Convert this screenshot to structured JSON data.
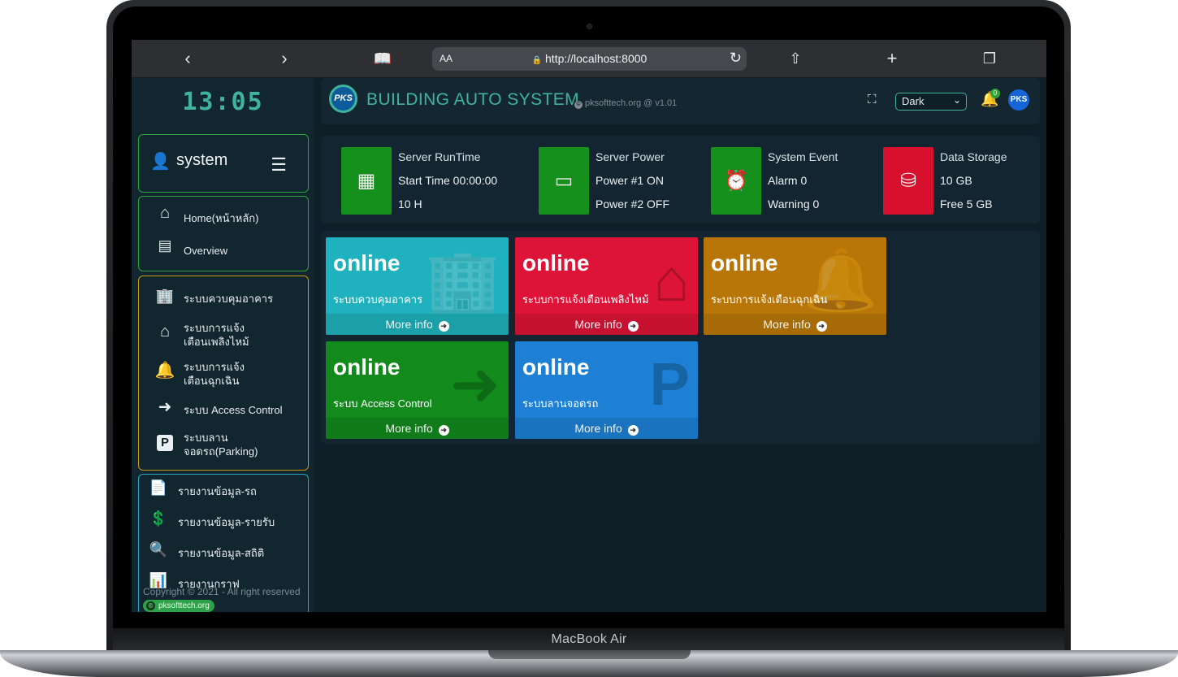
{
  "device": {
    "brand": "MacBook Air"
  },
  "browser": {
    "back_icon": "‹",
    "forward_icon": "›",
    "aa": "AA",
    "url": "http://localhost:8000",
    "lock_icon": "🔒"
  },
  "sidebar": {
    "clock": "13:05",
    "user": {
      "name": "system"
    },
    "menu": [
      {
        "label": "Home(หน้าหลัก)",
        "icon": "home-icon"
      },
      {
        "label": "Overview",
        "icon": "list-icon"
      }
    ],
    "systems": [
      {
        "label": "ระบบควบคุมอาคาร",
        "icon": "building-shield-icon"
      },
      {
        "label": "ระบบการแจ้ง\nเตือนเพลิงไหม้",
        "icon": "house-fire-icon"
      },
      {
        "label": "ระบบการแจ้ง\nเตือนฉุกเฉิน",
        "icon": "bell-icon"
      },
      {
        "label": "ระบบ Access Control",
        "icon": "sign-in-icon"
      },
      {
        "label": "ระบบลาน\nจอดรถ(Parking)",
        "icon": "parking-icon"
      }
    ],
    "reports": [
      {
        "label": "รายงานข้อมูล-รถ",
        "icon": "file-parking-icon"
      },
      {
        "label": "รายงานข้อมูล-รายรับ",
        "icon": "file-invoice-dollar-icon"
      },
      {
        "label": "รายงานข้อมูล-สถิติ",
        "icon": "magnify-chart-icon"
      },
      {
        "label": "รายงานกราฟ",
        "icon": "chart-bar-icon"
      }
    ],
    "copyright": "Copyright © 2021 - All right reserved",
    "badge": "pksofttech.org"
  },
  "topbar": {
    "logo": "PKS",
    "title": "BUILDING AUTO SYSTEM",
    "subtitle": "pksofttech.org  @ v1.01",
    "theme_value": "Dark",
    "notifications": "0",
    "avatar": "PKS"
  },
  "info_boxes": [
    {
      "title": "Server RunTime",
      "line1": "Start Time 00:00:00",
      "line2": "10 H",
      "color": "#16901c",
      "icon": "memory-icon"
    },
    {
      "title": "Server Power",
      "line1": "Power #1 ON",
      "line2": "Power #2 OFF",
      "color": "#16901c",
      "icon": "battery-icon"
    },
    {
      "title": "System Event",
      "line1": "Alarm 0",
      "line2": "Warning 0",
      "color": "#16901c",
      "icon": "toolbox-clock-icon"
    },
    {
      "title": "Data Storage",
      "line1": "10 GB",
      "line2": "Free 5 GB",
      "color": "#d6102d",
      "icon": "database-icon"
    }
  ],
  "status_cards": [
    {
      "status": "online",
      "label": "ระบบควบคุมอาคาร",
      "more": "More info",
      "color": "#1fb1bd",
      "icon": "building-shield-icon"
    },
    {
      "status": "online",
      "label": "ระบบการแจ้งเตือนเพลิงไหม้",
      "more": "More info",
      "color": "#dd1437",
      "icon": "house-fire-icon"
    },
    {
      "status": "online",
      "label": "ระบบการแจ้งเตือนฉุกเฉิน",
      "more": "More info",
      "color": "#b97608",
      "icon": "bell-icon"
    },
    {
      "status": "online",
      "label": "ระบบ Access Control",
      "more": "More info",
      "color": "#128a1c",
      "icon": "sign-in-icon"
    },
    {
      "status": "online",
      "label": "ระบบลานจอดรถ",
      "more": "More info",
      "color": "#1e80d4",
      "icon": "parking-icon"
    }
  ]
}
